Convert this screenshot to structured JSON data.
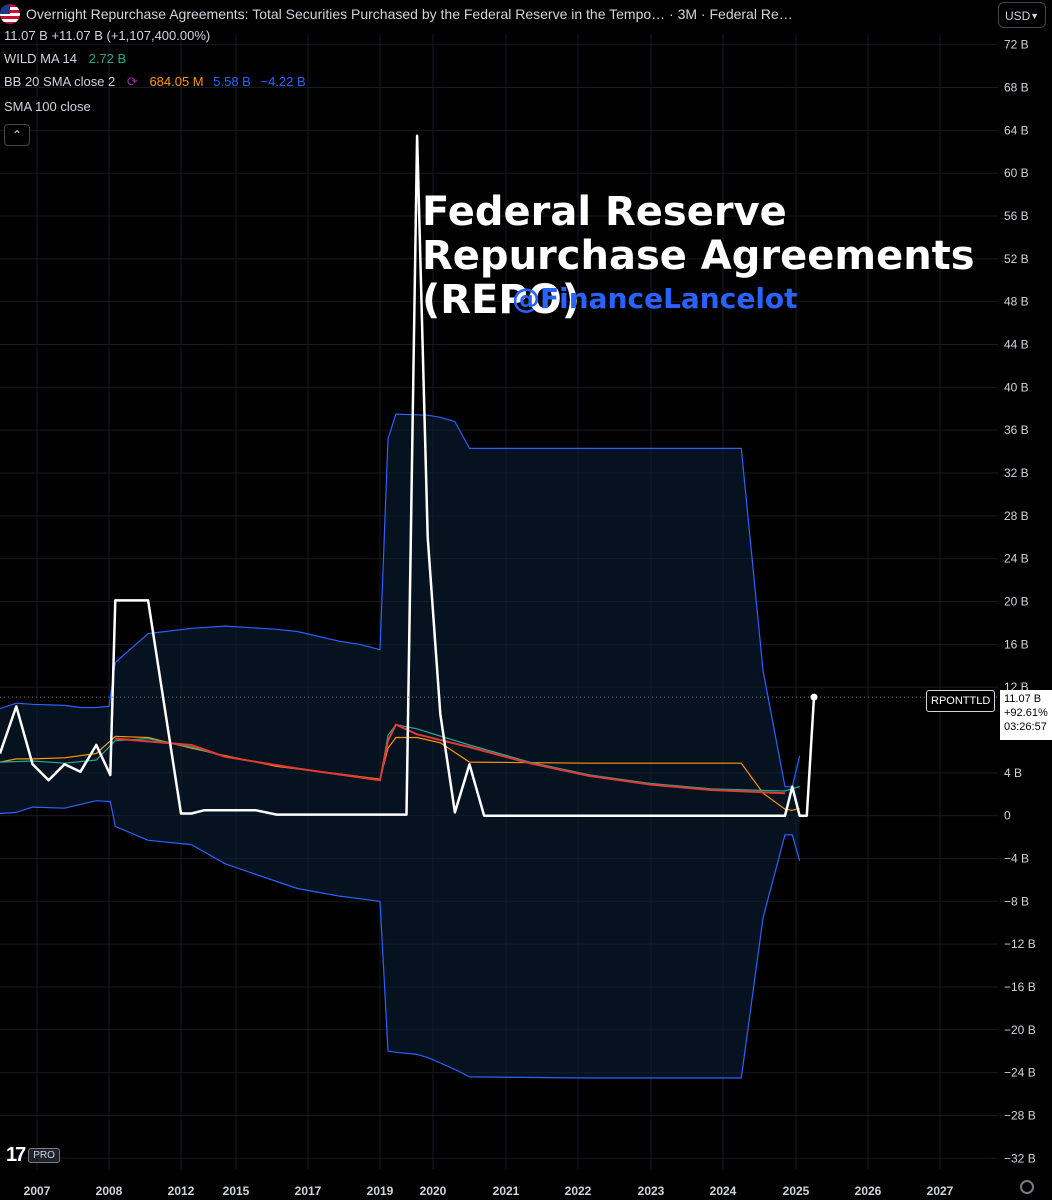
{
  "header": {
    "title": "Overnight Repurchase Agreements: Total Securities Purchased by the Federal Reserve in the Tempo… · 3M · Federal Re…",
    "flag_icon": "us-flag-icon",
    "ohlc": "11.07 B  +11.07 B (+1,107,400.00%)",
    "currency": "USD"
  },
  "indicators": {
    "wild": {
      "name": "WILD MA 14",
      "value": "2.72 B",
      "color": "#22ab94"
    },
    "bb": {
      "name": "BB 20 SMA close 2",
      "basis": "684.05 M",
      "upper": "5.58 B",
      "lower": "−4.22 B",
      "basis_color": "#ff9800",
      "band_color": "#2962ff",
      "icon": "cycle-icon"
    },
    "sma": {
      "name": "SMA 100 close"
    },
    "collapse_icon": "chevron-up-icon"
  },
  "annotations": {
    "headline": "Federal Reserve Repurchase Agreements (REPO)",
    "handle": "@FinanceLancelot"
  },
  "last_price": {
    "symbol": "RPONTTLD",
    "value": "11.07 B",
    "change": "+92.61%",
    "countdown": "03:26:57"
  },
  "branding": {
    "logo": "17",
    "badge": "PRO"
  },
  "chart_data": {
    "type": "line",
    "ylim": [
      -33,
      73
    ],
    "y_ticks": [
      72,
      68,
      64,
      60,
      56,
      52,
      48,
      44,
      40,
      36,
      32,
      28,
      24,
      20,
      16,
      12,
      4,
      0,
      -4,
      -8,
      -12,
      -16,
      -20,
      -24,
      -28,
      -32
    ],
    "y_tick_labels": [
      "72 B",
      "68 B",
      "64 B",
      "60 B",
      "56 B",
      "52 B",
      "48 B",
      "44 B",
      "40 B",
      "36 B",
      "32 B",
      "28 B",
      "24 B",
      "20 B",
      "16 B",
      "12 B",
      "4 B",
      "0",
      "−4 B",
      "−8 B",
      "−12 B",
      "−16 B",
      "−20 B",
      "−24 B",
      "−28 B",
      "−32 B"
    ],
    "x_ticks": [
      {
        "label": "2007",
        "x": 2007.0
      },
      {
        "label": "2008",
        "x": 2008.0
      },
      {
        "label": "2012",
        "x": 2012.0
      },
      {
        "label": "2015",
        "x": 2015.0
      },
      {
        "label": "2017",
        "x": 2017.0
      },
      {
        "label": "2019",
        "x": 2019.0
      },
      {
        "label": "2020",
        "x": 2020.0
      },
      {
        "label": "2021",
        "x": 2021.0
      },
      {
        "label": "2022",
        "x": 2022.0
      },
      {
        "label": "2023",
        "x": 2023.0
      },
      {
        "label": "2024",
        "x": 2024.0
      },
      {
        "label": "2025",
        "x": 2025.0
      },
      {
        "label": "2026",
        "x": 2026.0
      },
      {
        "label": "2027",
        "x": 2027.0
      }
    ],
    "series": [
      {
        "name": "RPONTTLD",
        "color": "#ffffff",
        "width": 2.5,
        "points": [
          [
            2006.5,
            5.8
          ],
          [
            2006.75,
            10.2
          ],
          [
            2007.0,
            4.8
          ],
          [
            2007.25,
            3.3
          ],
          [
            2007.5,
            4.8
          ],
          [
            2007.75,
            4.1
          ],
          [
            2008.0,
            6.6
          ],
          [
            2008.25,
            3.8
          ],
          [
            2008.45,
            20.1
          ],
          [
            2008.7,
            20.1
          ],
          [
            2008.95,
            0.2
          ],
          [
            2009.2,
            0.2
          ],
          [
            2009.5,
            0.5
          ],
          [
            2010.0,
            0.5
          ],
          [
            2010.5,
            0.5
          ],
          [
            2010.75,
            0.1
          ],
          [
            2011.5,
            0.1
          ],
          [
            2012.0,
            0.1
          ],
          [
            2012.5,
            0.1
          ],
          [
            2012.75,
            0.1
          ],
          [
            2013.0,
            63.5
          ],
          [
            2013.25,
            26.0
          ],
          [
            2013.5,
            9.5
          ],
          [
            2013.75,
            0.3
          ],
          [
            2014.0,
            4.8
          ],
          [
            2014.25,
            0.0
          ],
          [
            2015.0,
            0.0
          ],
          [
            2016.0,
            0.0
          ],
          [
            2017.0,
            0.0
          ],
          [
            2018.0,
            0.0
          ],
          [
            2019.0,
            0.0
          ],
          [
            2019.25,
            2.7
          ],
          [
            2019.5,
            0.0
          ],
          [
            2019.75,
            0.0
          ],
          [
            2020.0,
            11.07
          ]
        ]
      },
      {
        "name": "BB upper",
        "color": "#2962ff",
        "width": 1.2,
        "points": [
          [
            2006.5,
            10.0
          ],
          [
            2006.75,
            10.5
          ],
          [
            2007.0,
            10.4
          ],
          [
            2007.5,
            10.3
          ],
          [
            2007.75,
            10.1
          ],
          [
            2008.0,
            10.1
          ],
          [
            2008.2,
            10.2
          ],
          [
            2008.45,
            14.3
          ],
          [
            2008.7,
            17.0
          ],
          [
            2009.2,
            17.5
          ],
          [
            2010.0,
            17.7
          ],
          [
            2010.75,
            17.4
          ],
          [
            2011.0,
            17.2
          ],
          [
            2011.5,
            16.3
          ],
          [
            2011.75,
            16.0
          ],
          [
            2012.0,
            15.5
          ],
          [
            2012.25,
            35.2
          ],
          [
            2012.5,
            37.5
          ],
          [
            2013.25,
            37.4
          ],
          [
            2013.5,
            37.2
          ],
          [
            2013.75,
            36.8
          ],
          [
            2014.0,
            34.3
          ],
          [
            2016.0,
            34.3
          ],
          [
            2018.5,
            34.3
          ],
          [
            2018.75,
            13.5
          ],
          [
            2019.0,
            2.7
          ],
          [
            2019.25,
            2.7
          ],
          [
            2019.5,
            5.58
          ]
        ]
      },
      {
        "name": "BB lower",
        "color": "#2962ff",
        "width": 1.2,
        "points": [
          [
            2006.5,
            0.2
          ],
          [
            2006.75,
            0.3
          ],
          [
            2007.0,
            0.8
          ],
          [
            2007.5,
            0.7
          ],
          [
            2008.0,
            1.4
          ],
          [
            2008.25,
            1.3
          ],
          [
            2008.45,
            -1.0
          ],
          [
            2008.7,
            -2.3
          ],
          [
            2009.2,
            -2.7
          ],
          [
            2010.0,
            -4.5
          ],
          [
            2010.5,
            -5.5
          ],
          [
            2011.0,
            -6.8
          ],
          [
            2011.5,
            -7.5
          ],
          [
            2012.0,
            -8.0
          ],
          [
            2012.25,
            -22.0
          ],
          [
            2012.5,
            -22.1
          ],
          [
            2013.0,
            -22.3
          ],
          [
            2013.25,
            -22.6
          ],
          [
            2013.5,
            -23.1
          ],
          [
            2013.75,
            -23.7
          ],
          [
            2014.0,
            -24.4
          ],
          [
            2016.0,
            -24.5
          ],
          [
            2018.5,
            -24.5
          ],
          [
            2018.75,
            -9.5
          ],
          [
            2019.0,
            -1.8
          ],
          [
            2019.25,
            -1.8
          ],
          [
            2019.5,
            -4.22
          ]
        ]
      },
      {
        "name": "BB basis",
        "color": "#ff9800",
        "width": 1.2,
        "points": [
          [
            2006.5,
            5.0
          ],
          [
            2006.75,
            5.3
          ],
          [
            2007.0,
            5.3
          ],
          [
            2007.5,
            5.4
          ],
          [
            2008.0,
            5.8
          ],
          [
            2008.45,
            7.4
          ],
          [
            2008.7,
            7.3
          ],
          [
            2009.2,
            6.3
          ],
          [
            2010.0,
            5.6
          ],
          [
            2010.75,
            4.6
          ],
          [
            2011.5,
            3.9
          ],
          [
            2012.0,
            3.4
          ],
          [
            2012.25,
            6.3
          ],
          [
            2012.5,
            7.3
          ],
          [
            2013.0,
            7.3
          ],
          [
            2013.5,
            6.8
          ],
          [
            2014.0,
            5.0
          ],
          [
            2016.0,
            4.9
          ],
          [
            2018.5,
            4.9
          ],
          [
            2018.75,
            2.1
          ],
          [
            2019.0,
            0.6
          ],
          [
            2019.25,
            0.5
          ],
          [
            2019.5,
            0.68
          ]
        ]
      },
      {
        "name": "WILD MA 14",
        "color": "#22ab94",
        "width": 1.2,
        "points": [
          [
            2006.5,
            5.0
          ],
          [
            2007.0,
            5.1
          ],
          [
            2007.5,
            4.9
          ],
          [
            2008.0,
            5.2
          ],
          [
            2008.45,
            7.0
          ],
          [
            2008.7,
            7.2
          ],
          [
            2009.2,
            6.4
          ],
          [
            2010.0,
            5.5
          ],
          [
            2011.0,
            4.4
          ],
          [
            2012.0,
            3.3
          ],
          [
            2012.25,
            7.5
          ],
          [
            2012.5,
            8.5
          ],
          [
            2013.0,
            8.1
          ],
          [
            2014.0,
            6.6
          ],
          [
            2015.0,
            5.0
          ],
          [
            2016.0,
            3.8
          ],
          [
            2017.0,
            3.0
          ],
          [
            2018.0,
            2.5
          ],
          [
            2019.0,
            2.3
          ],
          [
            2019.5,
            2.72
          ]
        ]
      },
      {
        "name": "SMA 100",
        "color": "#e53935",
        "width": 2,
        "points": [
          [
            2008.45,
            7.2
          ],
          [
            2009.2,
            6.6
          ],
          [
            2010.0,
            5.5
          ],
          [
            2011.0,
            4.4
          ],
          [
            2012.0,
            3.3
          ],
          [
            2012.25,
            7.0
          ],
          [
            2012.5,
            8.5
          ],
          [
            2013.0,
            7.6
          ],
          [
            2014.0,
            6.4
          ],
          [
            2015.0,
            4.9
          ],
          [
            2016.0,
            3.7
          ],
          [
            2017.0,
            2.9
          ],
          [
            2018.0,
            2.4
          ],
          [
            2019.0,
            2.1
          ]
        ]
      }
    ]
  }
}
